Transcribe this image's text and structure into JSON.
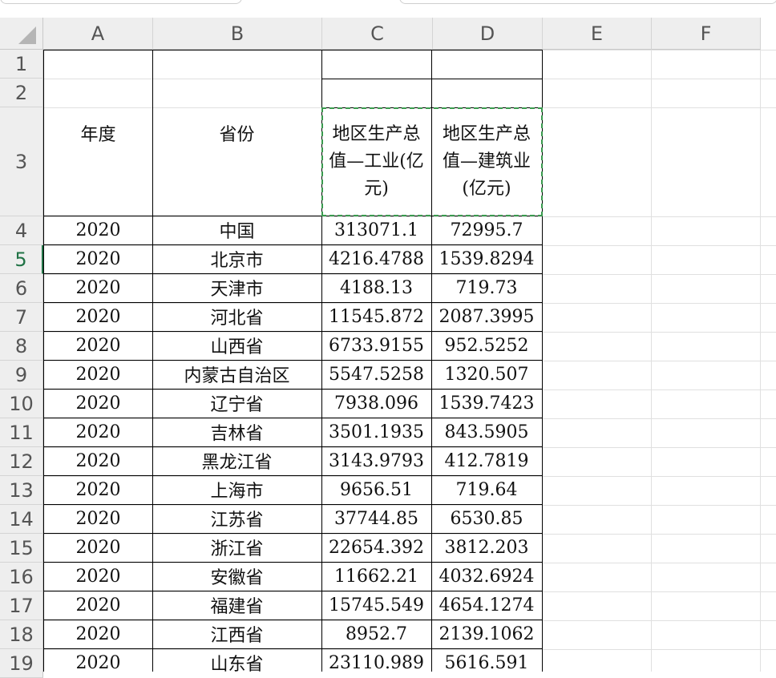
{
  "columns": [
    "A",
    "B",
    "C",
    "D",
    "E",
    "F"
  ],
  "row_numbers": [
    "1",
    "2",
    "3",
    "4",
    "5",
    "6",
    "7",
    "8",
    "9",
    "10",
    "11",
    "12",
    "13",
    "14",
    "15",
    "16",
    "17",
    "18",
    "19"
  ],
  "active_row": "5",
  "header": {
    "year": "年度",
    "province": "省份",
    "industry_gdp": "地区生产总值—工业(亿元)",
    "construction_gdp": "地区生产总值—建筑业(亿元)"
  },
  "rows": [
    {
      "year": "2020",
      "province": "中国",
      "industry": "313071.1",
      "construction": "72995.7"
    },
    {
      "year": "2020",
      "province": "北京市",
      "industry": "4216.4788",
      "construction": "1539.8294"
    },
    {
      "year": "2020",
      "province": "天津市",
      "industry": "4188.13",
      "construction": "719.73"
    },
    {
      "year": "2020",
      "province": "河北省",
      "industry": "11545.872",
      "construction": "2087.3995"
    },
    {
      "year": "2020",
      "province": "山西省",
      "industry": "6733.9155",
      "construction": "952.5252"
    },
    {
      "year": "2020",
      "province": "内蒙古自治区",
      "industry": "5547.5258",
      "construction": "1320.507"
    },
    {
      "year": "2020",
      "province": "辽宁省",
      "industry": "7938.096",
      "construction": "1539.7423"
    },
    {
      "year": "2020",
      "province": "吉林省",
      "industry": "3501.1935",
      "construction": "843.5905"
    },
    {
      "year": "2020",
      "province": "黑龙江省",
      "industry": "3143.9793",
      "construction": "412.7819"
    },
    {
      "year": "2020",
      "province": "上海市",
      "industry": "9656.51",
      "construction": "719.64"
    },
    {
      "year": "2020",
      "province": "江苏省",
      "industry": "37744.85",
      "construction": "6530.85"
    },
    {
      "year": "2020",
      "province": "浙江省",
      "industry": "22654.392",
      "construction": "3812.203"
    },
    {
      "year": "2020",
      "province": "安徽省",
      "industry": "11662.21",
      "construction": "4032.6924"
    },
    {
      "year": "2020",
      "province": "福建省",
      "industry": "15745.549",
      "construction": "4654.1274"
    },
    {
      "year": "2020",
      "province": "江西省",
      "industry": "8952.7",
      "construction": "2139.1062"
    },
    {
      "year": "2020",
      "province": "山东省",
      "industry": "23110.989",
      "construction": "5616.591"
    }
  ]
}
